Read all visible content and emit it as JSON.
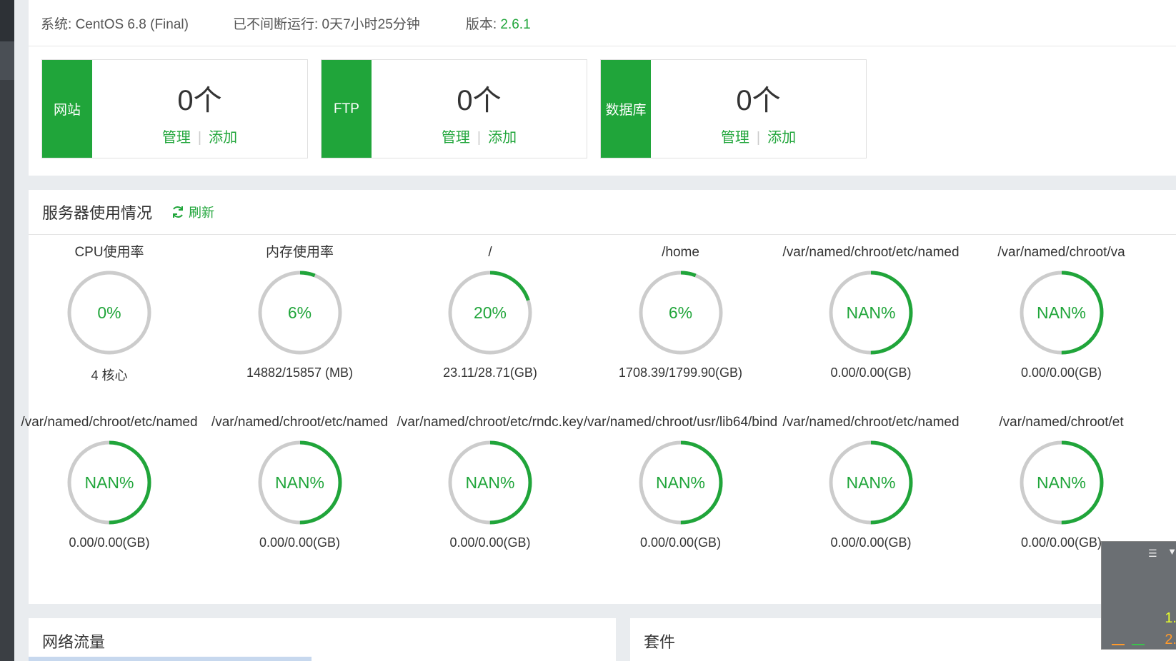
{
  "system": {
    "os_label": "系统:",
    "os_value": "CentOS 6.8 (Final)",
    "uptime_label": "已不间断运行:",
    "uptime_value": "0天7小时25分钟",
    "version_label": "版本:",
    "version_value": "2.6.1"
  },
  "stats": [
    {
      "tag": "网站",
      "count": "0个",
      "manage": "管理",
      "add": "添加"
    },
    {
      "tag": "FTP",
      "count": "0个",
      "manage": "管理",
      "add": "添加"
    },
    {
      "tag": "数据库",
      "count": "0个",
      "manage": "管理",
      "add": "添加"
    }
  ],
  "usage": {
    "title": "服务器使用情况",
    "refresh_label": "刷新",
    "refresh_icon": "refresh-icon",
    "gauges": [
      {
        "label": "CPU使用率",
        "percent_text": "0%",
        "fill": 0,
        "sub": "4 核心"
      },
      {
        "label": "内存使用率",
        "percent_text": "6%",
        "fill": 0.06,
        "sub": "14882/15857 (MB)"
      },
      {
        "label": "/",
        "percent_text": "20%",
        "fill": 0.2,
        "sub": "23.11/28.71(GB)"
      },
      {
        "label": "/home",
        "percent_text": "6%",
        "fill": 0.06,
        "sub": "1708.39/1799.90(GB)"
      },
      {
        "label": "/var/named/chroot/etc/named",
        "percent_text": "NAN%",
        "fill": 0.5,
        "sub": "0.00/0.00(GB)"
      },
      {
        "label": "/var/named/chroot/va",
        "percent_text": "NAN%",
        "fill": 0.5,
        "sub": "0.00/0.00(GB)"
      },
      {
        "label": "/var/named/chroot/etc/named",
        "percent_text": "NAN%",
        "fill": 0.5,
        "sub": "0.00/0.00(GB)"
      },
      {
        "label": "/var/named/chroot/etc/named",
        "percent_text": "NAN%",
        "fill": 0.5,
        "sub": "0.00/0.00(GB)"
      },
      {
        "label": "/var/named/chroot/etc/rndc.key",
        "percent_text": "NAN%",
        "fill": 0.5,
        "sub": "0.00/0.00(GB)"
      },
      {
        "label": "/var/named/chroot/usr/lib64/bind",
        "percent_text": "NAN%",
        "fill": 0.5,
        "sub": "0.00/0.00(GB)"
      },
      {
        "label": "/var/named/chroot/etc/named",
        "percent_text": "NAN%",
        "fill": 0.5,
        "sub": "0.00/0.00(GB)"
      },
      {
        "label": "/var/named/chroot/et",
        "percent_text": "NAN%",
        "fill": 0.5,
        "sub": "0.00/0.00(GB)"
      }
    ]
  },
  "network": {
    "title": "网络流量"
  },
  "suite": {
    "title": "套件"
  },
  "float_widget": {
    "value1": "1.",
    "value2": "2."
  },
  "colors": {
    "accent": "#20a53a",
    "track": "#cccccc"
  }
}
